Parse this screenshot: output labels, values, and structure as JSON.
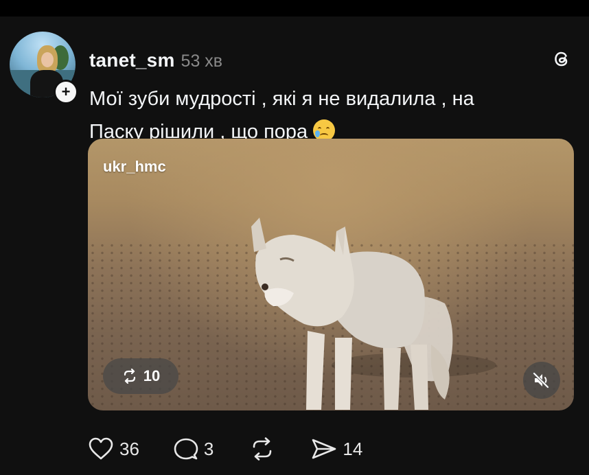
{
  "post": {
    "username": "tanet_sm",
    "time": "53 хв",
    "follow_icon": "plus",
    "caption_line1": "Мої зуби мудрості , які я не видалила , на",
    "caption_line2": "Паску рішили , що пора",
    "caption_emoji": "crying-face-emoji"
  },
  "media": {
    "watermark": "ukr_hmc",
    "repost_count": "10",
    "mute_icon": "speaker-muted-icon"
  },
  "actions": {
    "likes": "36",
    "replies": "3",
    "shares": "14"
  },
  "colors": {
    "background": "#101010",
    "text": "#f3f5f7",
    "secondary_text": "#8a8a8a"
  }
}
